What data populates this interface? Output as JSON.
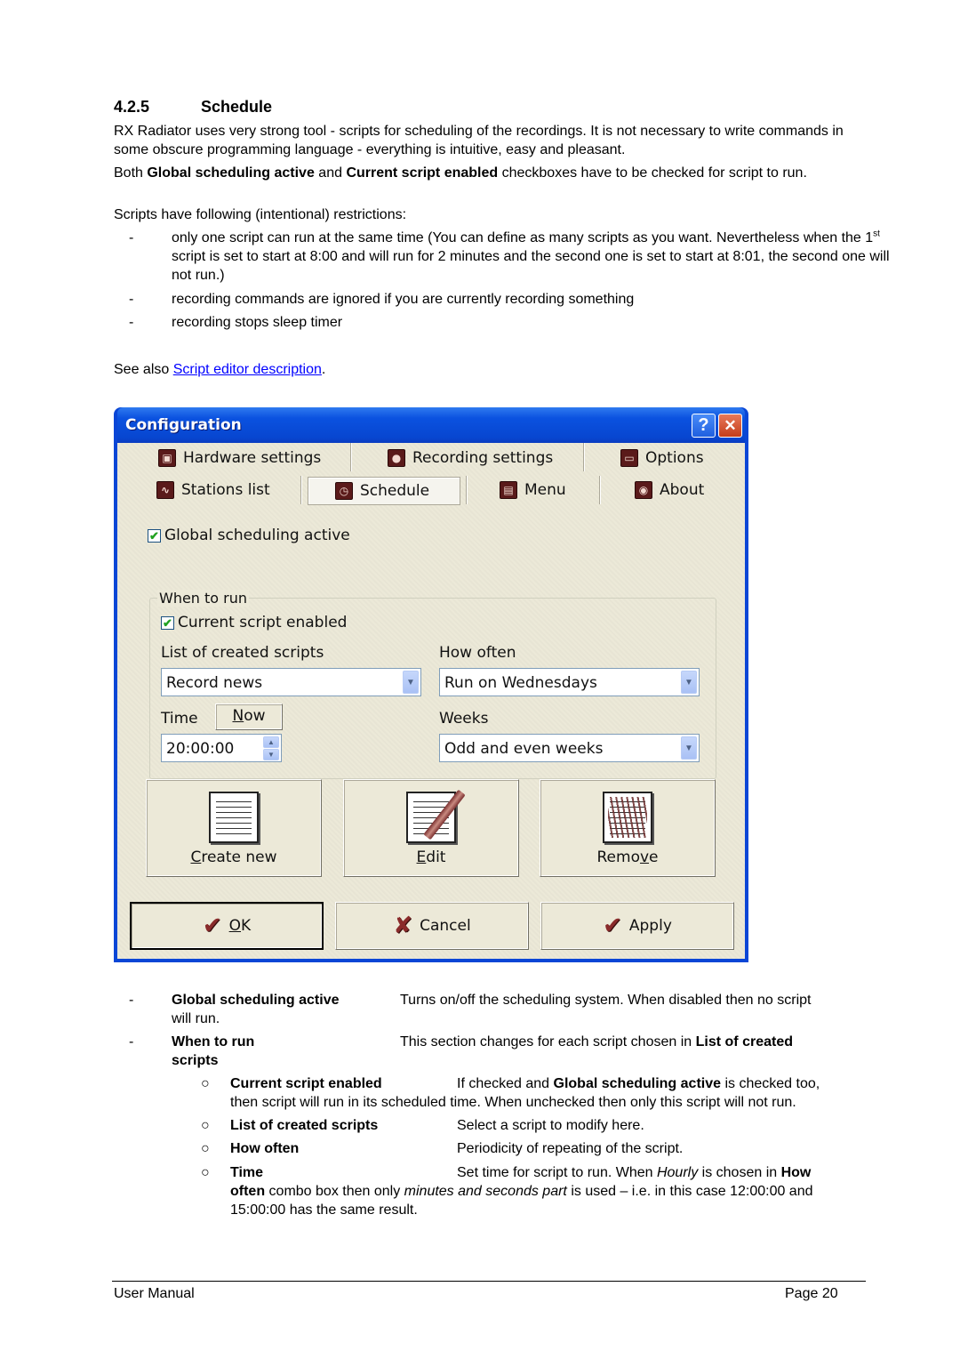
{
  "section": {
    "number": "4.2.5",
    "title": "Schedule"
  },
  "intro": {
    "p1": "RX Radiator uses very strong tool  - scripts for scheduling of the recordings. It is not necessary to write commands in some obscure programming language - everything is intuitive, easy and pleasant.",
    "p2_pre": "Both ",
    "p2_b1": "Global scheduling active",
    "p2_mid": " and ",
    "p2_b2": "Current script enabled",
    "p2_post": " checkboxes have to be checked for script to run.",
    "p3": "Scripts have following (intentional) restrictions:"
  },
  "restrictions": [
    {
      "dash": "-",
      "a": "only one script can run at the same time (You can define as many scripts as you want. Nevertheless when the 1",
      "sup": "st",
      "b": " script is set to start at 8:00 and will run for 2 minutes and the second one is set to start at 8:01, the second one will not run.)"
    },
    {
      "dash": "-",
      "a": "recording commands are ignored if you are currently recording something"
    },
    {
      "dash": "-",
      "a": "recording stops sleep timer"
    }
  ],
  "see_also": {
    "pre": "See also ",
    "link": "Script editor description",
    "post": "."
  },
  "dialog": {
    "title": "Configuration",
    "help_glyph": "?",
    "close_glyph": "✕",
    "nav_row1": [
      {
        "label": "Hardware settings",
        "icon": "plug-icon",
        "glyph": "▣"
      },
      {
        "label": "Recording settings",
        "icon": "record-icon",
        "glyph": "●"
      },
      {
        "label": "Options",
        "icon": "computer-icon",
        "glyph": "▭"
      }
    ],
    "nav_row2": [
      {
        "label": "Stations list",
        "icon": "signal-icon",
        "glyph": "∿"
      },
      {
        "label": "Schedule",
        "icon": "clock-icon",
        "glyph": "◷",
        "active": true
      },
      {
        "label": "Menu",
        "icon": "menu-icon",
        "glyph": "▤"
      },
      {
        "label": "About",
        "icon": "broadcast-icon",
        "glyph": "◉"
      }
    ],
    "global_checkbox": {
      "label": "Global scheduling active",
      "checked": true,
      "mark": "✔"
    },
    "group_title": "When to run",
    "current_checkbox": {
      "label": "Current script enabled",
      "checked": true,
      "mark": "✔"
    },
    "scripts_label": "List of created scripts",
    "scripts_value": "Record news",
    "how_often_label": "How often",
    "how_often_value": "Run on Wednesdays",
    "time_label": "Time",
    "now_button": {
      "accel": "N",
      "rest": "ow"
    },
    "time_value": "20:00:00",
    "weeks_label": "Weeks",
    "weeks_value": "Odd and even weeks",
    "combo_arrow": "▼",
    "spin_up": "▲",
    "spin_down": "▼",
    "create_button": {
      "accel": "C",
      "rest": "reate new"
    },
    "edit_button": {
      "accel": "E",
      "rest": "dit"
    },
    "remove_button": {
      "pre": "Remo",
      "accel": "v",
      "rest": "e"
    },
    "ok_button": {
      "accel": "O",
      "rest": "K",
      "glyph": "✔"
    },
    "cancel_button": {
      "label": "Cancel",
      "glyph": "✘"
    },
    "apply_button": {
      "label": "Apply",
      "glyph": "✔"
    }
  },
  "definitions": [
    {
      "marker": "-",
      "term": "Global scheduling active",
      "desc": "Turns on/off the scheduling system. When disabled then no script",
      "cont": "will run."
    },
    {
      "marker": "-",
      "term": "When to run",
      "desc_pre": "This section changes for each script chosen in ",
      "desc_b": "List of created",
      "cont_b": "scripts"
    },
    {
      "marker": "○",
      "term": "Current script enabled",
      "desc_pre": "If checked and ",
      "desc_b": "Global scheduling active",
      "desc_post": " is checked too,",
      "cont": "then script will run in its scheduled time. When unchecked then only this script will not run."
    },
    {
      "marker": "○",
      "term": "List of created scripts",
      "desc": "Select a script to modify here."
    },
    {
      "marker": "○",
      "term": "How often",
      "desc": "Periodicity of repeating of the script."
    },
    {
      "marker": "○",
      "term": "Time",
      "desc_pre": "Set time for script to run. When ",
      "desc_i": "Hourly",
      "desc_mid": " is chosen in ",
      "desc_b": "How",
      "cont_b": "often",
      "cont_mid": " combo box then only ",
      "cont_i": "minutes and seconds part",
      "cont_post": " is used – i.e. in this case 12:00:00 and",
      "cont2": "15:00:00 has the same result."
    }
  ],
  "footer": {
    "left": "User Manual",
    "right": "Page 20"
  }
}
